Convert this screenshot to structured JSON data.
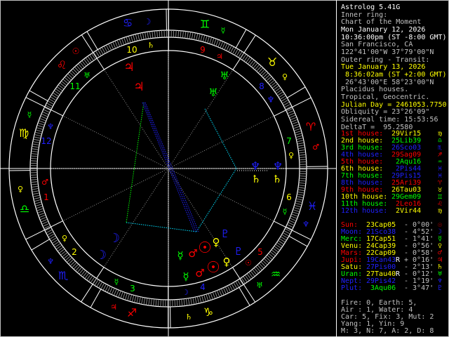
{
  "header": {
    "app_title": "Astrolog 5.41G",
    "inner_ring_label": "Inner ring:",
    "inner_chart_name": "Chart of the Moment",
    "inner_date": "Mon January 12, 2026",
    "inner_time": "10:36:00pm (ST -8:00 GMT)",
    "inner_location": "San Francisco, CA",
    "inner_coords": "122°41'00\"W 37°79'00\"N",
    "outer_ring_label": "Outer ring - Transit:",
    "outer_date": "Tue January 13, 2026",
    "outer_time": " 8:36:02am (ST +2:00 GMT)",
    "outer_coords": " 26°43'00\"E 58°23'00\"N",
    "house_system": "Placidus houses.",
    "zodiac": "Tropical, Geocentric.",
    "julian_day": "Julian Day = 2461053.7750",
    "obliquity": "Obliquity = 23°26'09\"",
    "sidereal_time": "Sidereal time: 15:53:56",
    "delta_t": "DeltaT =  95.2580"
  },
  "glyphs": {
    "aries": "♈",
    "taurus": "♉",
    "gemini": "♊",
    "cancer": "♋",
    "leo": "♌",
    "virgo": "♍",
    "libra": "♎",
    "scorpio": "♏",
    "sagittarius": "♐",
    "capricorn": "♑",
    "aquarius": "♒",
    "pisces": "♓",
    "sun": "☉",
    "moon": "☽",
    "mercury": "☿",
    "venus": "♀",
    "mars": "♂",
    "jupiter": "♃",
    "saturn": "♄",
    "uranus": "♅",
    "neptune": "♆",
    "pluto": "♇"
  },
  "colors": {
    "red": "#ff0000",
    "yellow": "#ffff00",
    "green": "#00ff00",
    "blue": "#2020ff",
    "grey": "#c0c0c0",
    "white": "#ffffff"
  },
  "houses": [
    {
      "label": "1st house:",
      "value": "29Vir15",
      "sign": "virgo",
      "label_color": "red",
      "value_color": "yellow"
    },
    {
      "label": "2nd house:",
      "value": "25Lib39",
      "sign": "libra",
      "label_color": "yellow",
      "value_color": "green"
    },
    {
      "label": "3rd house:",
      "value": "26Sco03",
      "sign": "scorpio",
      "label_color": "green",
      "value_color": "blue"
    },
    {
      "label": "4th house:",
      "value": "29Sag09",
      "sign": "sagittarius",
      "label_color": "blue",
      "value_color": "red"
    },
    {
      "label": "5th house:",
      "value": " 2Aqu16",
      "sign": "aquarius",
      "label_color": "red",
      "value_color": "green"
    },
    {
      "label": "6th house:",
      "value": " 2Pis44",
      "sign": "pisces",
      "label_color": "yellow",
      "value_color": "blue"
    },
    {
      "label": "7th house:",
      "value": "29Pis15",
      "sign": "pisces",
      "label_color": "green",
      "value_color": "blue"
    },
    {
      "label": "8th house:",
      "value": "25Ari39",
      "sign": "aries",
      "label_color": "blue",
      "value_color": "red"
    },
    {
      "label": "9th house:",
      "value": "26Tau03",
      "sign": "taurus",
      "label_color": "red",
      "value_color": "yellow"
    },
    {
      "label": "10th house:",
      "value": "29Gem09",
      "sign": "gemini",
      "label_color": "yellow",
      "value_color": "green"
    },
    {
      "label": "11th house:",
      "value": " 2Leo16",
      "sign": "leo",
      "label_color": "green",
      "value_color": "red"
    },
    {
      "label": "12th house:",
      "value": " 2Vir44",
      "sign": "virgo",
      "label_color": "blue",
      "value_color": "yellow"
    }
  ],
  "planets": [
    {
      "label": "Sun:",
      "value": "23Cap05",
      "retro": "",
      "lat": "- 0°00'",
      "glyph": "sun",
      "label_color": "red",
      "value_color": "yellow"
    },
    {
      "label": "Moon:",
      "value": "21Sco38",
      "retro": "",
      "lat": "- 4°52'",
      "glyph": "moon",
      "label_color": "blue",
      "value_color": "blue"
    },
    {
      "label": "Merc:",
      "value": "17Cap51",
      "retro": "",
      "lat": "- 1°41'",
      "glyph": "mercury",
      "label_color": "green",
      "value_color": "yellow"
    },
    {
      "label": "Venu:",
      "value": "24Cap39",
      "retro": "",
      "lat": "- 0°56'",
      "glyph": "venus",
      "label_color": "yellow",
      "value_color": "yellow"
    },
    {
      "label": "Mars:",
      "value": "22Cap09",
      "retro": "",
      "lat": "- 0°58'",
      "glyph": "mars",
      "label_color": "red",
      "value_color": "yellow"
    },
    {
      "label": "Jupi:",
      "value": "19Can43",
      "retro": "R",
      "lat": "+ 0°16'",
      "glyph": "jupiter",
      "label_color": "red",
      "value_color": "blue"
    },
    {
      "label": "Satu:",
      "value": "27Pis00",
      "retro": "",
      "lat": "- 2°13'",
      "glyph": "saturn",
      "label_color": "yellow",
      "value_color": "blue"
    },
    {
      "label": "Uran:",
      "value": "27Tau40",
      "retro": "R",
      "lat": "- 0°12'",
      "glyph": "uranus",
      "label_color": "green",
      "value_color": "yellow"
    },
    {
      "label": "Nept:",
      "value": "29Pis42",
      "retro": "",
      "lat": "- 1°19'",
      "glyph": "neptune",
      "label_color": "blue",
      "value_color": "blue"
    },
    {
      "label": "Plut:",
      "value": " 3Aqu06",
      "retro": "",
      "lat": "- 3°47'",
      "glyph": "pluto",
      "label_color": "blue",
      "value_color": "green"
    }
  ],
  "summary": [
    "Fire: 0, Earth: 5,",
    "Air : 1, Water: 4",
    "Car: 5, Fix: 3, Mut: 2",
    "Yang: 1, Yin: 9",
    "M: 3, N: 7, A: 2, D: 8"
  ],
  "chart": {
    "ascendant_longitude": 179.25,
    "house_cusps": [
      179.25,
      205.65,
      236.05,
      269.15,
      302.27,
      332.73,
      359.25,
      25.65,
      56.05,
      89.15,
      122.27,
      152.73
    ],
    "house_numbers": [
      "1",
      "2",
      "3",
      "4",
      "5",
      "6",
      "7",
      "8",
      "9",
      "10",
      "11",
      "12"
    ]
  }
}
